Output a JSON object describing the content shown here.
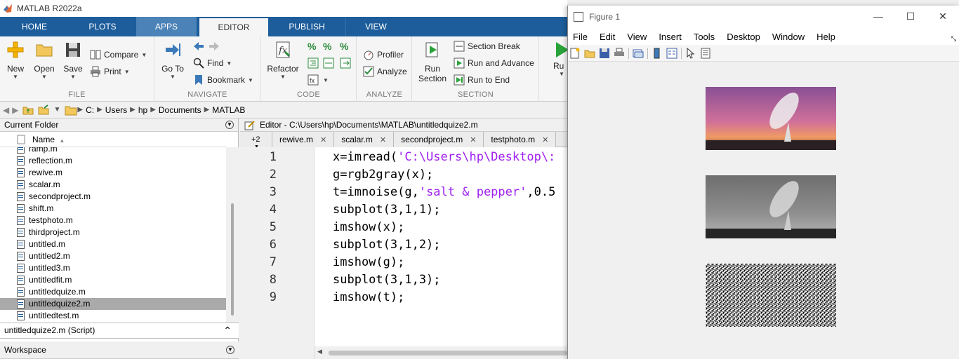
{
  "app": {
    "title": "MATLAB R2022a"
  },
  "tabs": [
    {
      "label": "HOME"
    },
    {
      "label": "PLOTS"
    },
    {
      "label": "APPS"
    },
    {
      "label": "EDITOR"
    },
    {
      "label": "PUBLISH"
    },
    {
      "label": "VIEW"
    }
  ],
  "ribbon": {
    "file": {
      "label": "FILE",
      "new": "New",
      "open": "Open",
      "save": "Save",
      "compare": "Compare",
      "print": "Print"
    },
    "navigate": {
      "label": "NAVIGATE",
      "goto": "Go To",
      "find": "Find",
      "bookmark": "Bookmark"
    },
    "code": {
      "label": "CODE",
      "refactor": "Refactor"
    },
    "analyze": {
      "label": "ANALYZE",
      "profiler": "Profiler",
      "analyze": "Analyze"
    },
    "section": {
      "label": "SECTION",
      "run_section": "Run",
      "run_section2": "Section",
      "section_break": "Section Break",
      "run_advance": "Run and Advance",
      "run_end": "Run to End",
      "run": "Ru"
    }
  },
  "address": {
    "path": [
      "C:",
      "Users",
      "hp",
      "Documents",
      "MATLAB"
    ]
  },
  "current_folder": {
    "title": "Current Folder",
    "column": "Name",
    "files": [
      "ramp.m",
      "reflection.m",
      "rewive.m",
      "scalar.m",
      "secondproject.m",
      "shift.m",
      "testphoto.m",
      "thirdproject.m",
      "untitled.m",
      "untitled2.m",
      "untitled3.m",
      "untitledfit.m",
      "untitledquize.m",
      "untitledquize2.m",
      "untitledtest.m"
    ],
    "selected": "untitledquize2.m",
    "detail": "untitledquize2.m  (Script)",
    "workspace": "Workspace"
  },
  "editor": {
    "header": "Editor - C:\\Users\\hp\\Documents\\MATLAB\\untitledquize2.m",
    "more_tabs": "+2",
    "tabs": [
      "rewive.m",
      "scalar.m",
      "secondproject.m",
      "testphoto.m"
    ],
    "lines": [
      {
        "n": "1",
        "pre": "x=imread(",
        "str": "'C:\\Users\\hp\\Desktop\\:",
        "post": ""
      },
      {
        "n": "2",
        "pre": "g=rgb2gray(x);",
        "str": "",
        "post": ""
      },
      {
        "n": "3",
        "pre": "t=imnoise(g,",
        "str": "'salt & pepper'",
        "post": ",0.5"
      },
      {
        "n": "4",
        "pre": "subplot(3,1,1);",
        "str": "",
        "post": ""
      },
      {
        "n": "5",
        "pre": "imshow(x);",
        "str": "",
        "post": ""
      },
      {
        "n": "6",
        "pre": "subplot(3,1,2);",
        "str": "",
        "post": ""
      },
      {
        "n": "7",
        "pre": "imshow(g);",
        "str": "",
        "post": ""
      },
      {
        "n": "8",
        "pre": "subplot(3,1,3);",
        "str": "",
        "post": ""
      },
      {
        "n": "9",
        "pre": "imshow(t);",
        "str": "",
        "post": ""
      }
    ],
    "string_color": "#a020f0"
  },
  "figure": {
    "title": "Figure 1",
    "menu": [
      "File",
      "Edit",
      "View",
      "Insert",
      "Tools",
      "Desktop",
      "Window",
      "Help"
    ],
    "minimize": "—",
    "maximize": "☐",
    "close": "✕"
  },
  "colors": {
    "ribbon_tab_bar": "#1d5d9b",
    "apps_tab": "#4b82b7",
    "selected_row": "#aaaaaa"
  }
}
